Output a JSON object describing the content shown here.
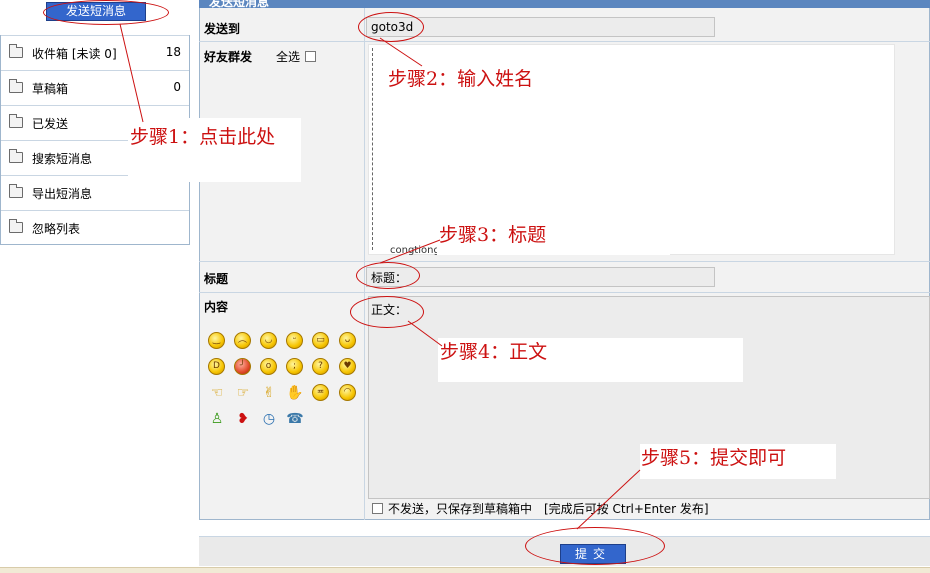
{
  "header": {
    "title": "发送短消息"
  },
  "sidebar": {
    "compose_label": "发送短消息",
    "items": [
      {
        "label": "收件箱 [未读 0]",
        "count": "18"
      },
      {
        "label": "草稿箱",
        "count": "0"
      },
      {
        "label": "已发送",
        "count": ""
      },
      {
        "label": "搜索短消息",
        "count": ""
      },
      {
        "label": "导出短消息",
        "count": ""
      },
      {
        "label": "忽略列表",
        "count": ""
      }
    ]
  },
  "form": {
    "to_label": "发送到",
    "to_value": "goto3d",
    "group_label": "好友群发",
    "select_all_label": "全选",
    "friend_overflow_text": "congtiong",
    "subject_label": "标题",
    "subject_value": "标题：",
    "content_label": "内容",
    "content_value": "正文：",
    "draft_label": "不发送，只保存到草稿箱中",
    "hint_label": "[完成后可按 Ctrl+Enter 发布]",
    "submit_label": "提交"
  },
  "emoticons": [
    "smile-icon",
    "sad-icon",
    "happy-icon",
    "wink-icon",
    "grin-icon",
    "tongue-icon",
    "laugh-icon",
    "angry-icon",
    "shocked-icon",
    "cry-icon",
    "confused-icon",
    "cool-icon",
    "thumb-left-icon",
    "thumb-right-icon",
    "victory-icon",
    "handshake-icon",
    "annoyed-icon",
    "blush-icon",
    "person-icon",
    "lips-icon",
    "clock-icon",
    "phone-icon"
  ],
  "annotations": {
    "step1": "步骤1：点击此处",
    "step2": "步骤2：输入姓名",
    "step3": "步骤3：标题",
    "step4": "步骤4：正文",
    "step5": "步骤5：提交即可"
  },
  "colors": {
    "accent_blue": "#3366cc",
    "annotation_red": "#cc1111",
    "header_blue": "#5b86bf"
  }
}
